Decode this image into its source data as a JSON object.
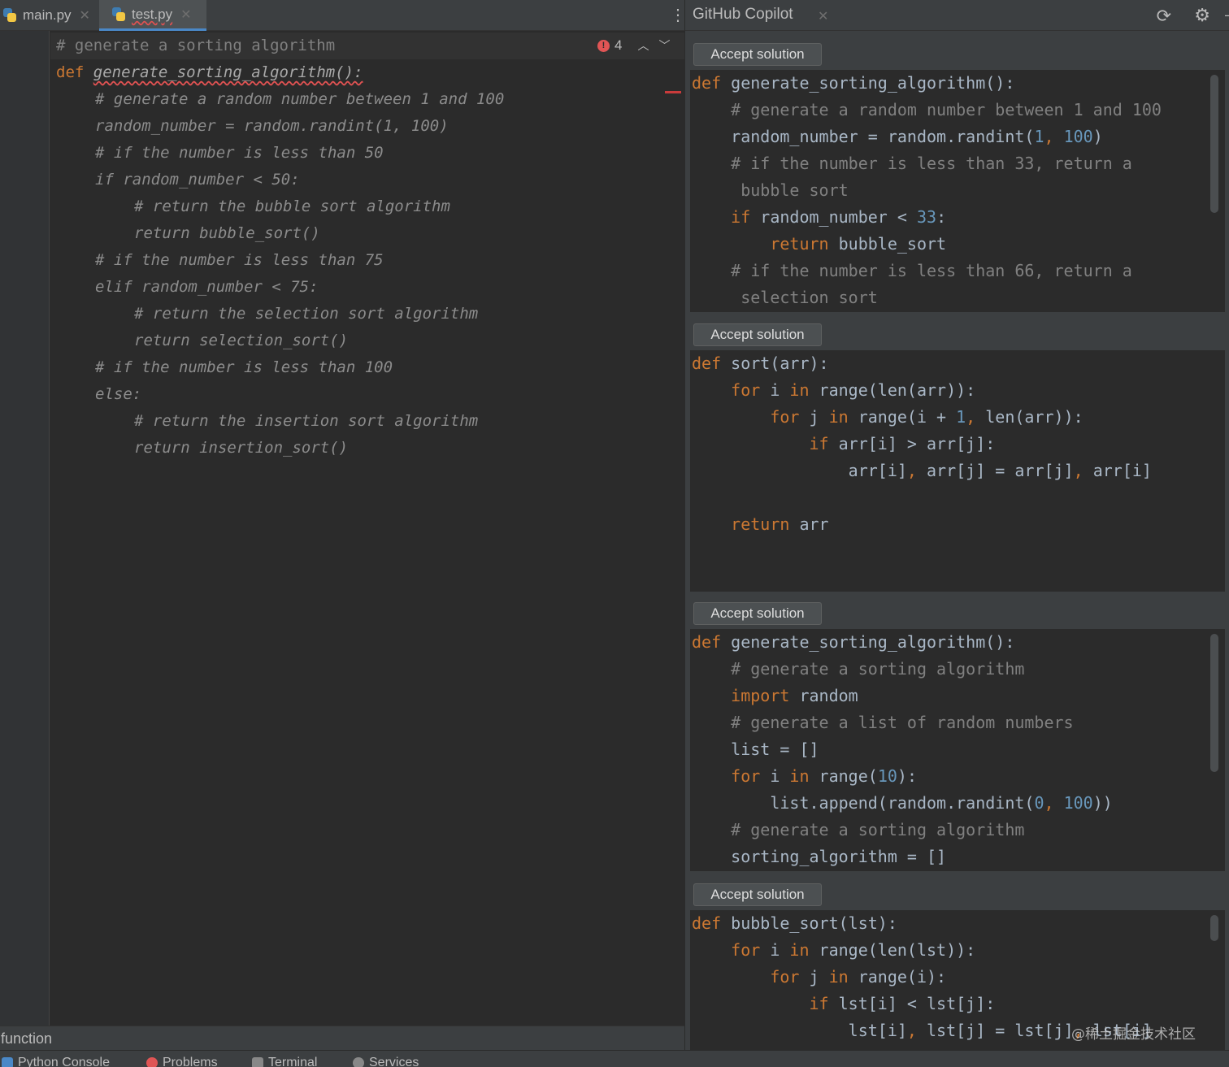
{
  "editor": {
    "tabs": [
      {
        "label": "main.py",
        "active": false
      },
      {
        "label": "test.py",
        "active": true
      }
    ],
    "inspection_count": "4",
    "lines": [
      {
        "indent": 0,
        "parts": [
          {
            "t": "# generate a sorting algorithm",
            "c": "c"
          }
        ]
      },
      {
        "indent": 0,
        "parts": [
          {
            "t": "def",
            "c": "kw"
          },
          {
            "t": " ",
            "c": ""
          },
          {
            "t": "generate_sorting_algorithm():",
            "c": "fn-italic wavy"
          }
        ]
      },
      {
        "indent": 1,
        "parts": [
          {
            "t": "# generate a random number between 1 and 100",
            "c": "it"
          }
        ]
      },
      {
        "indent": 1,
        "parts": [
          {
            "t": "random_number = random.randint(1, 100)",
            "c": "it"
          }
        ]
      },
      {
        "indent": 1,
        "parts": [
          {
            "t": "# if the number is less than 50",
            "c": "it"
          }
        ]
      },
      {
        "indent": 1,
        "parts": [
          {
            "t": "if random_number < 50:",
            "c": "it"
          }
        ]
      },
      {
        "indent": 2,
        "parts": [
          {
            "t": "# return the bubble sort algorithm",
            "c": "it"
          }
        ]
      },
      {
        "indent": 2,
        "parts": [
          {
            "t": "return bubble_sort()",
            "c": "it"
          }
        ]
      },
      {
        "indent": 1,
        "parts": [
          {
            "t": "# if the number is less than 75",
            "c": "it"
          }
        ]
      },
      {
        "indent": 1,
        "parts": [
          {
            "t": "elif random_number < 75:",
            "c": "it"
          }
        ]
      },
      {
        "indent": 2,
        "parts": [
          {
            "t": "# return the selection sort algorithm",
            "c": "it"
          }
        ]
      },
      {
        "indent": 2,
        "parts": [
          {
            "t": "return selection_sort()",
            "c": "it"
          }
        ]
      },
      {
        "indent": 1,
        "parts": [
          {
            "t": "# if the number is less than 100",
            "c": "it"
          }
        ]
      },
      {
        "indent": 1,
        "parts": [
          {
            "t": "else:",
            "c": "it"
          }
        ]
      },
      {
        "indent": 2,
        "parts": [
          {
            "t": "# return the insertion sort algorithm",
            "c": "it"
          }
        ]
      },
      {
        "indent": 2,
        "parts": [
          {
            "t": "return insertion_sort()",
            "c": "it"
          }
        ]
      }
    ],
    "status_hint": "function"
  },
  "copilot": {
    "title": "GitHub Copilot",
    "accept_label": "Accept solution",
    "solutions": [
      {
        "lines": [
          [
            {
              "t": "def",
              "c": "kw"
            },
            {
              "t": " generate_sorting_algorithm():",
              "c": ""
            }
          ],
          [
            {
              "t": "    # generate a random number between 1 and 100",
              "c": "c"
            }
          ],
          [
            {
              "t": "    random_number = random.randint(",
              "c": ""
            },
            {
              "t": "1",
              "c": "num"
            },
            {
              "t": ", ",
              "c": "kw"
            },
            {
              "t": "100",
              "c": "num"
            },
            {
              "t": ")",
              "c": ""
            }
          ],
          [
            {
              "t": "    # if the number is less than 33, return a",
              "c": "c"
            }
          ],
          [
            {
              "t": "     bubble sort",
              "c": "c"
            }
          ],
          [
            {
              "t": "    ",
              "c": ""
            },
            {
              "t": "if",
              "c": "kw"
            },
            {
              "t": " random_number < ",
              "c": ""
            },
            {
              "t": "33",
              "c": "num"
            },
            {
              "t": ":",
              "c": ""
            }
          ],
          [
            {
              "t": "        ",
              "c": ""
            },
            {
              "t": "return",
              "c": "kw"
            },
            {
              "t": " bubble_sort",
              "c": ""
            }
          ],
          [
            {
              "t": "    # if the number is less than 66, return a",
              "c": "c"
            }
          ],
          [
            {
              "t": "     selection sort",
              "c": "c"
            }
          ]
        ]
      },
      {
        "lines": [
          [
            {
              "t": "def",
              "c": "kw"
            },
            {
              "t": " sort(arr):",
              "c": ""
            }
          ],
          [
            {
              "t": "    ",
              "c": ""
            },
            {
              "t": "for",
              "c": "kw"
            },
            {
              "t": " i ",
              "c": ""
            },
            {
              "t": "in",
              "c": "kw"
            },
            {
              "t": " range(len(arr)):",
              "c": ""
            }
          ],
          [
            {
              "t": "        ",
              "c": ""
            },
            {
              "t": "for",
              "c": "kw"
            },
            {
              "t": " j ",
              "c": ""
            },
            {
              "t": "in",
              "c": "kw"
            },
            {
              "t": " range(i + ",
              "c": ""
            },
            {
              "t": "1",
              "c": "num"
            },
            {
              "t": ", ",
              "c": "kw"
            },
            {
              "t": "len(arr)):",
              "c": ""
            }
          ],
          [
            {
              "t": "            ",
              "c": ""
            },
            {
              "t": "if",
              "c": "kw"
            },
            {
              "t": " arr[i] > arr[j]:",
              "c": ""
            }
          ],
          [
            {
              "t": "                arr[i]",
              "c": ""
            },
            {
              "t": ", ",
              "c": "kw"
            },
            {
              "t": "arr[j] = arr[j]",
              "c": ""
            },
            {
              "t": ", ",
              "c": "kw"
            },
            {
              "t": "arr[i]",
              "c": ""
            }
          ],
          [
            {
              "t": "",
              "c": ""
            }
          ],
          [
            {
              "t": "    ",
              "c": ""
            },
            {
              "t": "return",
              "c": "kw"
            },
            {
              "t": " arr",
              "c": ""
            }
          ]
        ]
      },
      {
        "lines": [
          [
            {
              "t": "def",
              "c": "kw"
            },
            {
              "t": " generate_sorting_algorithm():",
              "c": ""
            }
          ],
          [
            {
              "t": "    # generate a sorting algorithm",
              "c": "c"
            }
          ],
          [
            {
              "t": "    ",
              "c": ""
            },
            {
              "t": "import",
              "c": "kw"
            },
            {
              "t": " random",
              "c": ""
            }
          ],
          [
            {
              "t": "    # generate a list of random numbers",
              "c": "c"
            }
          ],
          [
            {
              "t": "    list = []",
              "c": ""
            }
          ],
          [
            {
              "t": "    ",
              "c": ""
            },
            {
              "t": "for",
              "c": "kw"
            },
            {
              "t": " i ",
              "c": ""
            },
            {
              "t": "in",
              "c": "kw"
            },
            {
              "t": " range(",
              "c": ""
            },
            {
              "t": "10",
              "c": "num"
            },
            {
              "t": "):",
              "c": ""
            }
          ],
          [
            {
              "t": "        list.append(random.randint(",
              "c": ""
            },
            {
              "t": "0",
              "c": "num"
            },
            {
              "t": ", ",
              "c": "kw"
            },
            {
              "t": "100",
              "c": "num"
            },
            {
              "t": "))",
              "c": ""
            }
          ],
          [
            {
              "t": "    # generate a sorting algorithm",
              "c": "c"
            }
          ],
          [
            {
              "t": "    sorting_algorithm = []",
              "c": ""
            }
          ]
        ]
      },
      {
        "lines": [
          [
            {
              "t": "def",
              "c": "kw"
            },
            {
              "t": " bubble_sort(lst):",
              "c": ""
            }
          ],
          [
            {
              "t": "    ",
              "c": ""
            },
            {
              "t": "for",
              "c": "kw"
            },
            {
              "t": " i ",
              "c": ""
            },
            {
              "t": "in",
              "c": "kw"
            },
            {
              "t": " range(len(lst)):",
              "c": ""
            }
          ],
          [
            {
              "t": "        ",
              "c": ""
            },
            {
              "t": "for",
              "c": "kw"
            },
            {
              "t": " j ",
              "c": ""
            },
            {
              "t": "in",
              "c": "kw"
            },
            {
              "t": " range(i):",
              "c": ""
            }
          ],
          [
            {
              "t": "            ",
              "c": ""
            },
            {
              "t": "if",
              "c": "kw"
            },
            {
              "t": " lst[i] < lst[j]:",
              "c": ""
            }
          ],
          [
            {
              "t": "                lst[i]",
              "c": ""
            },
            {
              "t": ", ",
              "c": "kw"
            },
            {
              "t": "lst[j] = lst[j]",
              "c": ""
            },
            {
              "t": ", ",
              "c": "kw"
            },
            {
              "t": "lst[i]",
              "c": ""
            }
          ]
        ]
      }
    ]
  },
  "tool_windows": [
    {
      "label": "Python Console",
      "icon": "python-console-icon",
      "color": "#4a88c7"
    },
    {
      "label": "Problems",
      "icon": "problems-icon",
      "color": "#e05555"
    },
    {
      "label": "Terminal",
      "icon": "terminal-icon",
      "color": "#888888"
    },
    {
      "label": "Services",
      "icon": "services-icon",
      "color": "#888888"
    }
  ],
  "watermark": "@稀土掘金技术社区"
}
